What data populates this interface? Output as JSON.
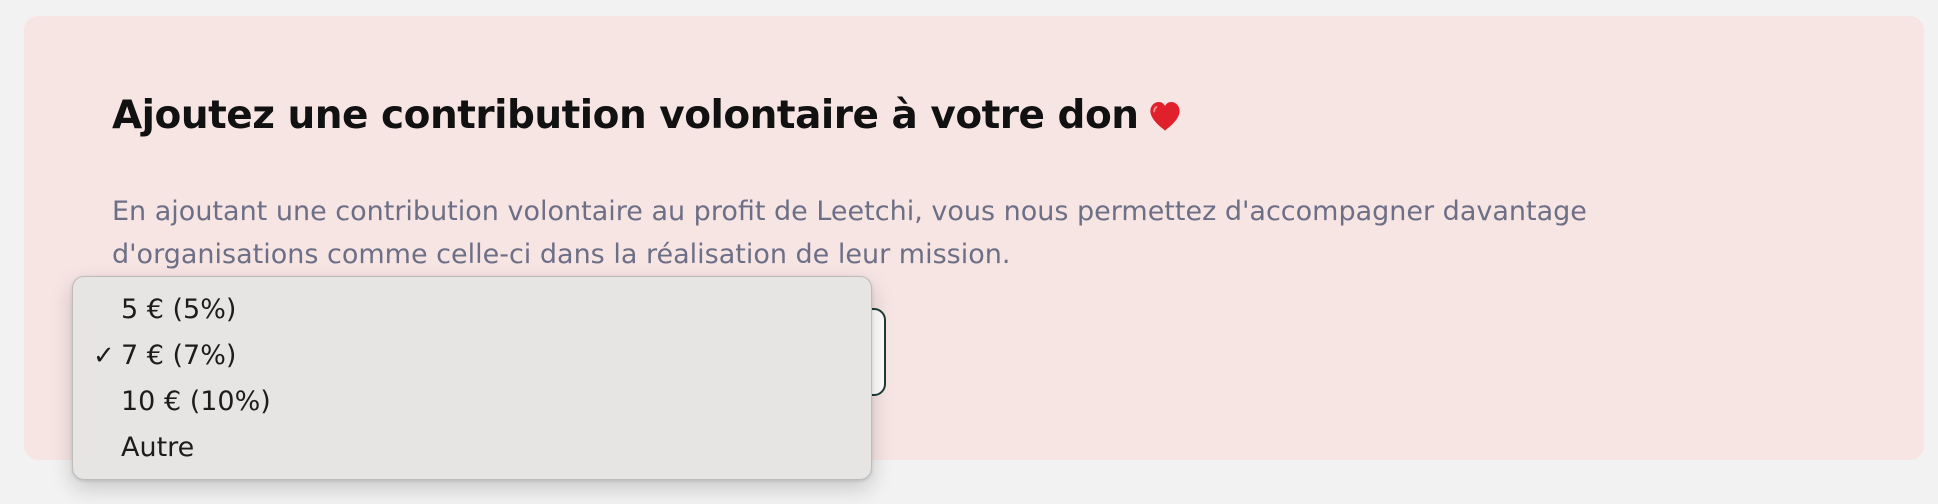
{
  "card": {
    "title": "Ajoutez une contribution volontaire à votre don",
    "title_emoji_icon": "red-heart-icon",
    "description": "En ajoutant une contribution volontaire au profit de Leetchi, vous nous permettez d'accompagner davantage d'organisations comme celle-ci dans la réalisation de leur mission."
  },
  "contribution_select": {
    "selected_value": "7 € (7%)",
    "options": [
      {
        "label": "5 € (5%)",
        "selected": false
      },
      {
        "label": "7 € (7%)",
        "selected": true
      },
      {
        "label": "10 € (10%)",
        "selected": false
      },
      {
        "label": "Autre",
        "selected": false
      }
    ],
    "checkmark": "✓"
  },
  "colors": {
    "page_background": "#f2f2f2",
    "card_background": "#f7e5e3",
    "title": "#111111",
    "description": "#6c6f86",
    "select_border": "#1e3d36",
    "menu_background": "#e6e5e3",
    "heart": "#e0202a"
  }
}
